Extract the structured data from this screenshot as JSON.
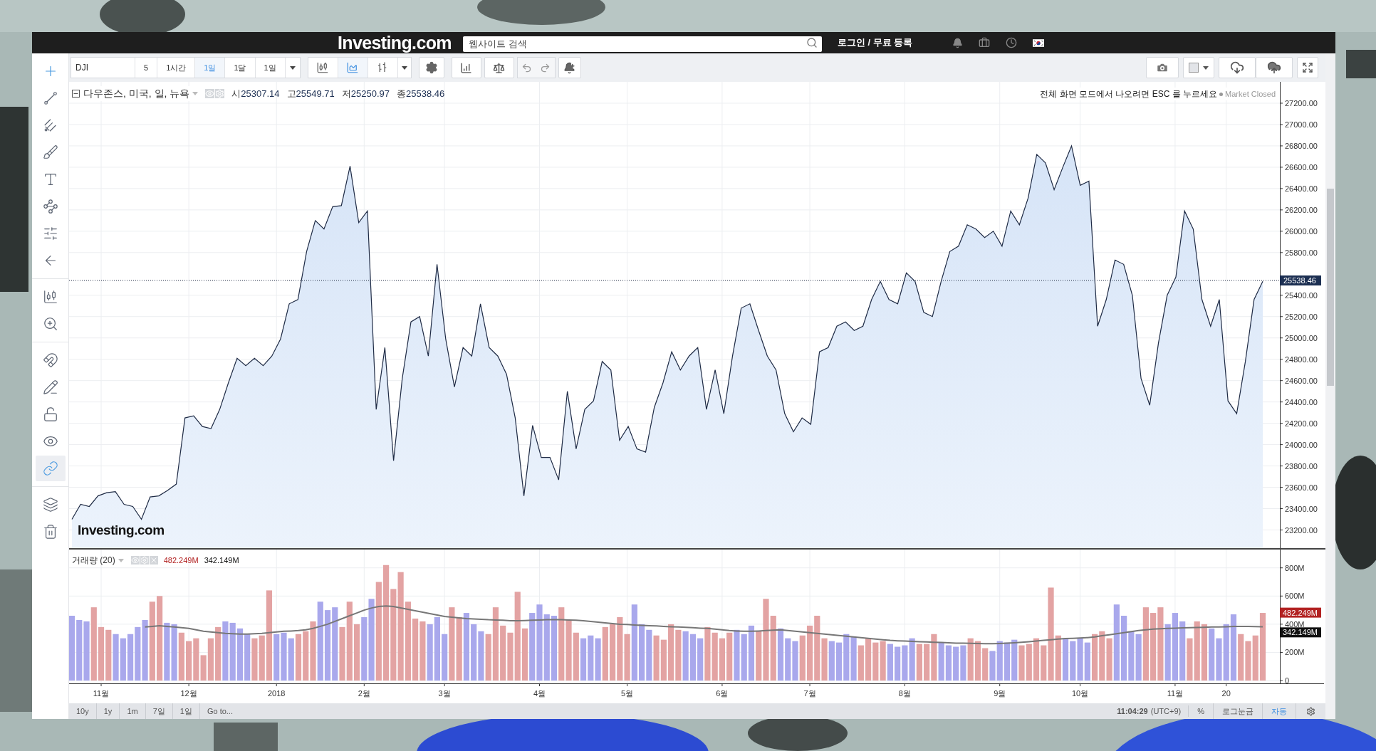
{
  "top_bar": {
    "logo": "Investing.com",
    "search": {
      "placeholder": "웹사이트 검색"
    },
    "login": "로그인 / 무료 등록"
  },
  "toolbar": {
    "symbol": "DJI",
    "intervals": [
      {
        "label": "5",
        "selected": false
      },
      {
        "label": "1시간",
        "selected": false
      },
      {
        "label": "1일",
        "selected": true
      },
      {
        "label": "1달",
        "selected": false
      },
      {
        "label": "1일",
        "selected": false
      }
    ],
    "chart_types": [
      {
        "kind": "candles",
        "selected": false
      },
      {
        "kind": "area",
        "selected": true
      },
      {
        "kind": "bars",
        "selected": false
      }
    ]
  },
  "tool_groups": [
    {
      "tools": [
        {
          "kind": "crosshair",
          "active": true,
          "selected": false
        },
        {
          "kind": "trend_line",
          "active": false,
          "selected": false
        },
        {
          "kind": "pitchfork",
          "active": false,
          "selected": false
        },
        {
          "kind": "brush",
          "active": false,
          "selected": false
        },
        {
          "kind": "text",
          "active": false,
          "selected": false
        },
        {
          "kind": "pattern",
          "active": false,
          "selected": false
        },
        {
          "kind": "fibonacci",
          "active": false,
          "selected": false
        },
        {
          "kind": "back",
          "active": false,
          "selected": false
        }
      ]
    },
    {
      "tools": [
        {
          "kind": "measure",
          "active": false,
          "selected": false
        },
        {
          "kind": "zoom",
          "active": false,
          "selected": false
        }
      ]
    },
    {
      "tools": [
        {
          "kind": "magnet",
          "active": false,
          "selected": false
        },
        {
          "kind": "lock_drawing",
          "active": false,
          "selected": false
        },
        {
          "kind": "unlock",
          "active": false,
          "selected": false
        },
        {
          "kind": "visibility",
          "active": false,
          "selected": false
        },
        {
          "kind": "link",
          "active": true,
          "selected": true
        }
      ]
    },
    {
      "tools": [
        {
          "kind": "layers",
          "active": false,
          "selected": false
        },
        {
          "kind": "trash",
          "active": false,
          "selected": false
        }
      ]
    }
  ],
  "price_pane": {
    "title": "다우존스, 미국, 일, 뉴욕",
    "ohlc": [
      {
        "label": "시",
        "value": "25307.14"
      },
      {
        "label": "고",
        "value": "25549.71"
      },
      {
        "label": "저",
        "value": "25250.97"
      },
      {
        "label": "종",
        "value": "25538.46"
      }
    ],
    "notice": "전체 화면 모드에서 나오려면 ESC 를 누르세요",
    "market_status": "Market Closed",
    "watermark": "Investing.com",
    "chart_data": {
      "type": "area",
      "grid": true,
      "ylim": [
        23030,
        27400
      ],
      "ref_lines": [
        {
          "axis": "y",
          "value": 25538.46,
          "label": "25538.46"
        }
      ],
      "yticks": [
        {
          "value": 23200,
          "label": "23200.00"
        },
        {
          "value": 23400,
          "label": "23400.00"
        },
        {
          "value": 23600,
          "label": "23600.00"
        },
        {
          "value": 23800,
          "label": "23800.00"
        },
        {
          "value": 24000,
          "label": "24000.00"
        },
        {
          "value": 24200,
          "label": "24200.00"
        },
        {
          "value": 24400,
          "label": "24400.00"
        },
        {
          "value": 24600,
          "label": "24600.00"
        },
        {
          "value": 24800,
          "label": "24800.00"
        },
        {
          "value": 25000,
          "label": "25000.00"
        },
        {
          "value": 25200,
          "label": "25200.00"
        },
        {
          "value": 25400,
          "label": "25400.00"
        },
        {
          "value": 25800,
          "label": "25800.00"
        },
        {
          "value": 26000,
          "label": "26000.00"
        },
        {
          "value": 26200,
          "label": "26200.00"
        },
        {
          "value": 26400,
          "label": "26400.00"
        },
        {
          "value": 26600,
          "label": "26600.00"
        },
        {
          "value": 26800,
          "label": "26800.00"
        },
        {
          "value": 27000,
          "label": "27000.00"
        },
        {
          "value": 27200,
          "label": "27200.00"
        }
      ],
      "categories": [
        null,
        null,
        null,
        null,
        null,
        null,
        null,
        null,
        null,
        null,
        null,
        null,
        null,
        null,
        null,
        null,
        null,
        null,
        null,
        null,
        null,
        null,
        null,
        null,
        null,
        null,
        null,
        null,
        null,
        null,
        null,
        null,
        null,
        null,
        null,
        null,
        null,
        null,
        null,
        null,
        null,
        null,
        null,
        null,
        null,
        null,
        null,
        null,
        null,
        null,
        null,
        null,
        null,
        null,
        null,
        null,
        null,
        null,
        null,
        null,
        null,
        null,
        null,
        null,
        null,
        null,
        null,
        null,
        null,
        null,
        null,
        null,
        null,
        null,
        null,
        null,
        null,
        null,
        null,
        null,
        null,
        null,
        null,
        null,
        null,
        null,
        null,
        null,
        null,
        null,
        null,
        null,
        null,
        null,
        null,
        null,
        null,
        null,
        null,
        null,
        null,
        null,
        null,
        null,
        null,
        null,
        null,
        null,
        null,
        null,
        null,
        null,
        null,
        null,
        null,
        null,
        null,
        null,
        null,
        null,
        null,
        null,
        null,
        null,
        null,
        null,
        null,
        null,
        null,
        null,
        null,
        null,
        null,
        null,
        null,
        null,
        null,
        null
      ],
      "values": [
        23300,
        23440,
        23420,
        23520,
        23550,
        23560,
        23440,
        23420,
        23300,
        23510,
        23520,
        23570,
        23630,
        24250,
        24270,
        24170,
        24150,
        24330,
        24580,
        24810,
        24740,
        24810,
        24740,
        24830,
        24990,
        25320,
        25360,
        25810,
        26100,
        26020,
        26230,
        26240,
        26610,
        26080,
        26190,
        24330,
        24910,
        23850,
        24620,
        25150,
        25200,
        24830,
        25690,
        24990,
        24540,
        24910,
        24830,
        25320,
        24910,
        24830,
        24660,
        24250,
        23520,
        24180,
        23880,
        23880,
        23670,
        24500,
        23960,
        24330,
        24410,
        24780,
        24700,
        24040,
        24170,
        23960,
        23930,
        24350,
        24580,
        24870,
        24700,
        24830,
        24910,
        24330,
        24700,
        24290,
        24830,
        25280,
        25320,
        25070,
        24830,
        24700,
        24290,
        24120,
        24250,
        24190,
        24870,
        24910,
        25110,
        25150,
        25070,
        25110,
        25360,
        25530,
        25360,
        25320,
        25610,
        25530,
        25240,
        25200,
        25530,
        25810,
        25860,
        26060,
        26020,
        25940,
        26000,
        25860,
        26190,
        26060,
        26310,
        26720,
        26640,
        26390,
        26600,
        26800,
        26430,
        26470,
        25110,
        25360,
        25730,
        25690,
        25400,
        24620,
        24370,
        24950,
        25400,
        25570,
        26190,
        26020,
        25360,
        25110,
        25360,
        24410,
        24290,
        24780,
        25360,
        25530
      ]
    }
  },
  "volume_pane": {
    "readings": [
      {
        "label": "482.249M",
        "color": "#b22222"
      },
      {
        "label": "342.149M",
        "color": "#111111"
      }
    ],
    "markers": [
      {
        "label": "482.249M",
        "color": "#b22222"
      },
      {
        "label": "342.149M",
        "color": "#111111"
      }
    ],
    "chart_data": {
      "type": "bar",
      "title": "거래량 (20)",
      "grid": true,
      "ylim": [
        -20,
        930
      ],
      "yticks": [
        {
          "value": 0,
          "label": "0"
        },
        {
          "value": 200,
          "label": "200M"
        },
        {
          "value": 400,
          "label": "400M"
        },
        {
          "value": 600,
          "label": "600M"
        },
        {
          "value": 800,
          "label": "800M"
        }
      ],
      "categories": [
        null,
        null,
        null,
        null,
        "11월",
        null,
        null,
        null,
        null,
        null,
        null,
        null,
        null,
        null,
        null,
        null,
        "12월",
        null,
        null,
        null,
        null,
        null,
        null,
        null,
        null,
        null,
        null,
        null,
        "2018",
        null,
        null,
        null,
        null,
        null,
        null,
        null,
        null,
        null,
        null,
        null,
        "2월",
        null,
        null,
        null,
        null,
        null,
        null,
        null,
        null,
        null,
        null,
        "3월",
        null,
        null,
        null,
        null,
        null,
        null,
        null,
        null,
        null,
        null,
        null,
        null,
        "4월",
        null,
        null,
        null,
        null,
        null,
        null,
        null,
        null,
        null,
        null,
        null,
        "5월",
        null,
        null,
        null,
        null,
        null,
        null,
        null,
        null,
        null,
        null,
        null,
        null,
        "6월",
        null,
        null,
        null,
        null,
        null,
        null,
        null,
        null,
        null,
        null,
        null,
        "7월",
        null,
        null,
        null,
        null,
        null,
        null,
        null,
        null,
        null,
        null,
        null,
        null,
        "8월",
        null,
        null,
        null,
        null,
        null,
        null,
        null,
        null,
        null,
        null,
        null,
        null,
        "9월",
        null,
        null,
        null,
        null,
        null,
        null,
        null,
        null,
        null,
        null,
        "10월",
        null,
        null,
        null,
        null,
        null,
        null,
        null,
        null,
        null,
        null,
        null,
        null,
        "11월",
        null,
        null,
        null,
        null,
        null,
        null,
        "20",
        null,
        null,
        null,
        null,
        null
      ],
      "series": [
        {
          "type": "bar",
          "color": "#e3a3a3",
          "values": [
            null,
            null,
            null,
            520,
            380,
            360,
            null,
            null,
            null,
            null,
            null,
            560,
            600,
            null,
            null,
            340,
            280,
            300,
            180,
            300,
            380,
            null,
            null,
            null,
            null,
            300,
            320,
            640,
            null,
            null,
            null,
            330,
            350,
            420,
            null,
            null,
            null,
            380,
            560,
            400,
            null,
            null,
            700,
            820,
            650,
            770,
            560,
            440,
            420,
            null,
            null,
            null,
            520,
            450,
            null,
            null,
            null,
            330,
            520,
            390,
            340,
            630,
            370,
            null,
            null,
            null,
            null,
            520,
            430,
            340,
            null,
            null,
            null,
            380,
            400,
            450,
            330,
            null,
            null,
            null,
            320,
            290,
            400,
            360,
            null,
            null,
            null,
            380,
            340,
            300,
            340,
            null,
            null,
            null,
            350,
            580,
            460,
            null,
            null,
            null,
            320,
            390,
            460,
            300,
            null,
            null,
            null,
            null,
            250,
            300,
            270,
            280,
            null,
            null,
            null,
            null,
            260,
            260,
            330,
            null,
            null,
            null,
            null,
            300,
            280,
            230,
            null,
            null,
            null,
            null,
            250,
            260,
            300,
            250,
            660,
            320,
            null,
            null,
            null,
            null,
            330,
            350,
            300,
            null,
            null,
            null,
            null,
            520,
            480,
            520,
            null,
            null,
            null,
            300,
            420,
            400,
            null,
            null,
            null,
            null,
            330,
            280,
            320,
            480
          ]
        },
        {
          "type": "bar",
          "color": "#a9a8ec",
          "values": [
            460,
            430,
            420,
            null,
            null,
            null,
            330,
            300,
            330,
            380,
            430,
            null,
            null,
            410,
            400,
            null,
            null,
            null,
            null,
            null,
            null,
            420,
            410,
            370,
            330,
            null,
            null,
            null,
            330,
            340,
            300,
            null,
            null,
            null,
            560,
            500,
            520,
            null,
            null,
            null,
            450,
            580,
            null,
            null,
            null,
            null,
            null,
            null,
            null,
            400,
            450,
            330,
            null,
            null,
            480,
            400,
            350,
            null,
            null,
            null,
            null,
            null,
            null,
            480,
            540,
            470,
            460,
            null,
            null,
            null,
            300,
            320,
            300,
            null,
            null,
            null,
            null,
            540,
            400,
            360,
            null,
            null,
            null,
            null,
            350,
            330,
            300,
            null,
            null,
            null,
            null,
            360,
            330,
            390,
            null,
            null,
            null,
            370,
            300,
            280,
            null,
            null,
            null,
            null,
            280,
            270,
            330,
            310,
            null,
            null,
            null,
            null,
            260,
            240,
            250,
            300,
            null,
            null,
            null,
            270,
            250,
            240,
            250,
            null,
            null,
            null,
            210,
            280,
            270,
            290,
            null,
            null,
            null,
            null,
            null,
            null,
            300,
            280,
            300,
            270,
            null,
            null,
            null,
            540,
            460,
            350,
            330,
            null,
            null,
            null,
            400,
            480,
            420,
            null,
            null,
            null,
            370,
            300,
            400,
            470,
            null,
            null,
            null,
            null
          ]
        },
        {
          "type": "line",
          "color": "#777777",
          "values": [
            null,
            null,
            null,
            null,
            null,
            null,
            null,
            null,
            null,
            null,
            380,
            385,
            390,
            385,
            380,
            375,
            370,
            360,
            350,
            345,
            340,
            335,
            332,
            330,
            330,
            332,
            335,
            340,
            345,
            350,
            352,
            355,
            360,
            370,
            385,
            400,
            420,
            440,
            460,
            480,
            500,
            515,
            525,
            530,
            525,
            515,
            505,
            495,
            485,
            475,
            465,
            455,
            450,
            445,
            440,
            438,
            435,
            432,
            430,
            428,
            425,
            425,
            426,
            428,
            430,
            432,
            433,
            432,
            430,
            428,
            425,
            420,
            415,
            410,
            405,
            400,
            398,
            395,
            392,
            390,
            388,
            385,
            382,
            380,
            378,
            375,
            372,
            370,
            365,
            360,
            355,
            352,
            350,
            350,
            352,
            355,
            358,
            360,
            355,
            350,
            345,
            340,
            335,
            330,
            325,
            320,
            315,
            310,
            305,
            300,
            295,
            290,
            285,
            282,
            280,
            278,
            276,
            274,
            272,
            270,
            268,
            266,
            265,
            264,
            263,
            262,
            262,
            263,
            265,
            268,
            272,
            276,
            280,
            285,
            290,
            295,
            298,
            300,
            302,
            305,
            310,
            318,
            325,
            332,
            340,
            348,
            355,
            360,
            365,
            368,
            370,
            372,
            374,
            375,
            376,
            378,
            380,
            380,
            382,
            384,
            385,
            384,
            383,
            382
          ]
        }
      ]
    }
  },
  "bottom_bar": {
    "ranges": [
      "10y",
      "1y",
      "1m",
      "7일",
      "1일"
    ],
    "goto": "Go to...",
    "time": "11:04:29",
    "timezone": "(UTC+9)",
    "options": [
      {
        "label": "%",
        "selected": false
      },
      {
        "label": "로그눈금",
        "selected": false
      },
      {
        "label": "자동",
        "selected": true
      }
    ]
  }
}
